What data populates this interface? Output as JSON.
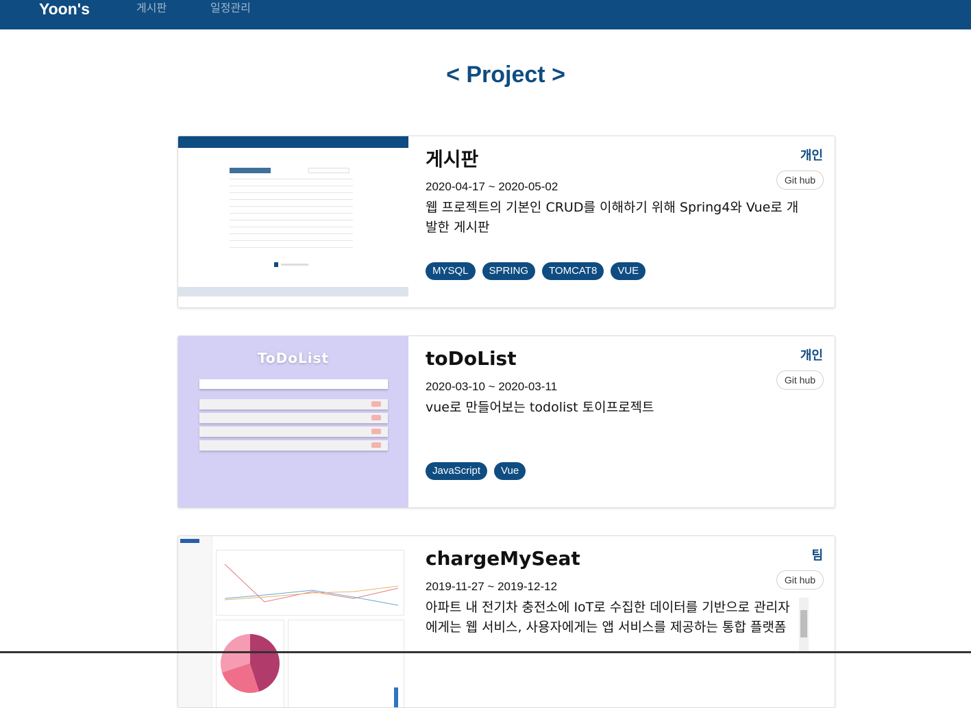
{
  "nav": {
    "brand": "Yoon's",
    "links": [
      "게시판",
      "일정관리"
    ]
  },
  "page_title": "< Project >",
  "projects": [
    {
      "title": "게시판",
      "type": "개인",
      "git_label": "Git hub",
      "date": "2020-04-17 ~ 2020-05-02",
      "description": "웹 프로젝트의 기본인 CRUD를 이해하기 위해 Spring4와 Vue로 개발한 게시판",
      "tags": [
        "MYSQL",
        "SPRING",
        "TOMCAT8",
        "VUE"
      ]
    },
    {
      "title": "toDoList",
      "type": "개인",
      "git_label": "Git hub",
      "date": "2020-03-10 ~ 2020-03-11",
      "description": "vue로 만들어보는 todolist 토이프로젝트",
      "tags": [
        "JavaScript",
        "Vue"
      ],
      "thumb_title": "ToDoList"
    },
    {
      "title": "chargeMySeat",
      "type": "팀",
      "git_label": "Git hub",
      "date": "2019-11-27 ~ 2019-12-12",
      "description": "아파트 내 전기차 충전소에 IoT로 수집한 데이터를 기반으로 관리자에게는 웹 서비스, 사용자에게는 앱 서비스를 제공하는 통합 플랫폼",
      "tags": []
    }
  ],
  "colors": {
    "primary": "#0f4c81",
    "todo_bg": "#d4cff5"
  }
}
